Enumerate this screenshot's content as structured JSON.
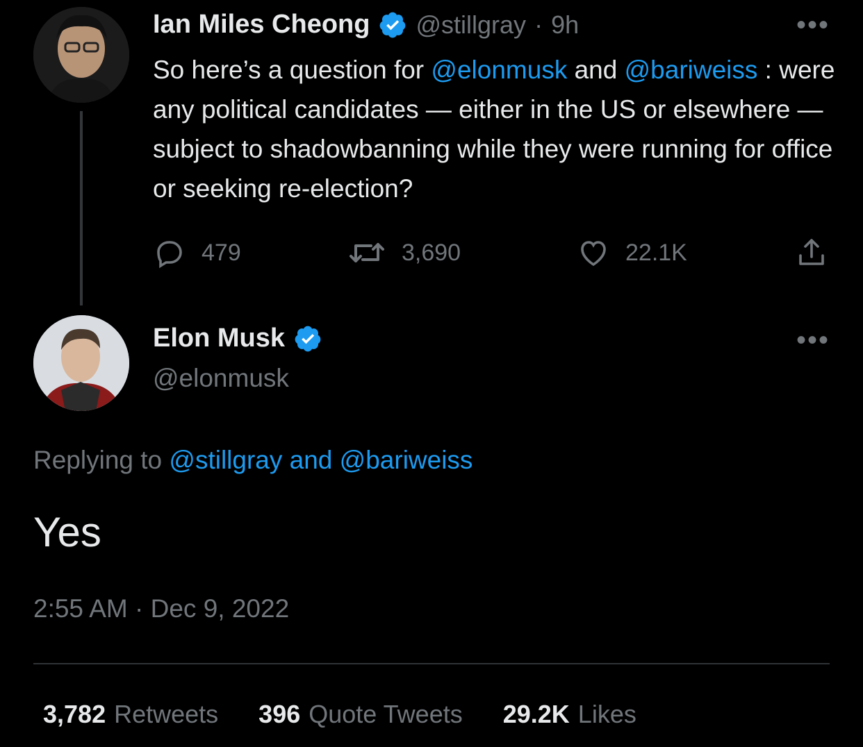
{
  "parent_tweet": {
    "author_name": "Ian Miles Cheong",
    "author_handle": "@stillgray",
    "separator": "·",
    "time_ago": "9h",
    "text_parts": [
      {
        "text": "So here’s a question for ",
        "link": false
      },
      {
        "text": "@elonmusk",
        "link": true
      },
      {
        "text": " and ",
        "link": false
      },
      {
        "text": "@bariweiss",
        "link": true
      },
      {
        "text": " : were any political candidates — either in the US or elsewhere — subject to shadowbanning while they were running for office or seeking re-election?",
        "link": false
      }
    ],
    "replies": "479",
    "retweets": "3,690",
    "likes": "22.1K"
  },
  "main_tweet": {
    "author_name": "Elon Musk",
    "author_handle": "@elonmusk",
    "replying_prefix": "Replying to",
    "replying_targets": "@stillgray and @bariweiss",
    "text": "Yes",
    "timestamp": "2:55 AM · Dec 9, 2022"
  },
  "stats": {
    "retweets_count": "3,782",
    "retweets_label": "Retweets",
    "quotes_count": "396",
    "quotes_label": "Quote Tweets",
    "likes_count": "29.2K",
    "likes_label": "Likes"
  },
  "icons": {
    "verified": "verified-badge-icon",
    "reply": "reply-icon",
    "retweet": "retweet-icon",
    "like": "heart-icon",
    "share": "share-icon",
    "more": "more-icon"
  },
  "colors": {
    "background": "#000000",
    "text": "#e7e9ea",
    "muted": "#71767b",
    "accent": "#1d9bf0",
    "divider": "#2f3336"
  }
}
